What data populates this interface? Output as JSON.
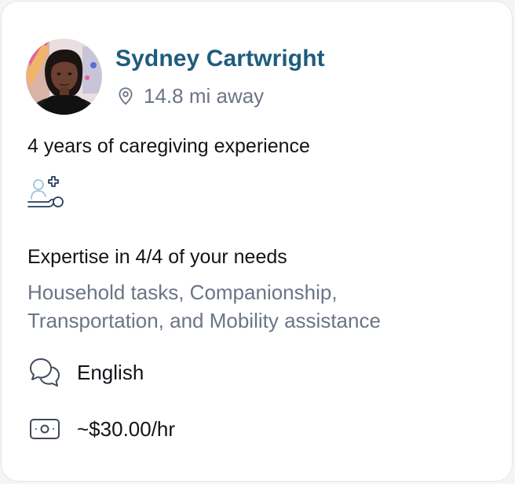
{
  "caregiver": {
    "name": "Sydney Cartwright",
    "distance": "14.8 mi away",
    "experience": "4 years of caregiving experience",
    "expertise_title": "Expertise in 4/4 of your needs",
    "expertise_list": "Household tasks, Companionship, Transportation, and Mobility assistance",
    "language": "English",
    "rate": "~$30.00/hr"
  },
  "icons": {
    "avatar": "profile-photo",
    "distance": "location-pin-icon",
    "experience": "caregiver-medical-icon",
    "language": "chat-bubbles-icon",
    "rate": "cash-icon"
  },
  "colors": {
    "name": "#1f5c7d",
    "muted_text": "#6b7585",
    "body_text": "#111418",
    "icon_navy": "#263d5f",
    "icon_light_blue": "#9ec4dc"
  }
}
